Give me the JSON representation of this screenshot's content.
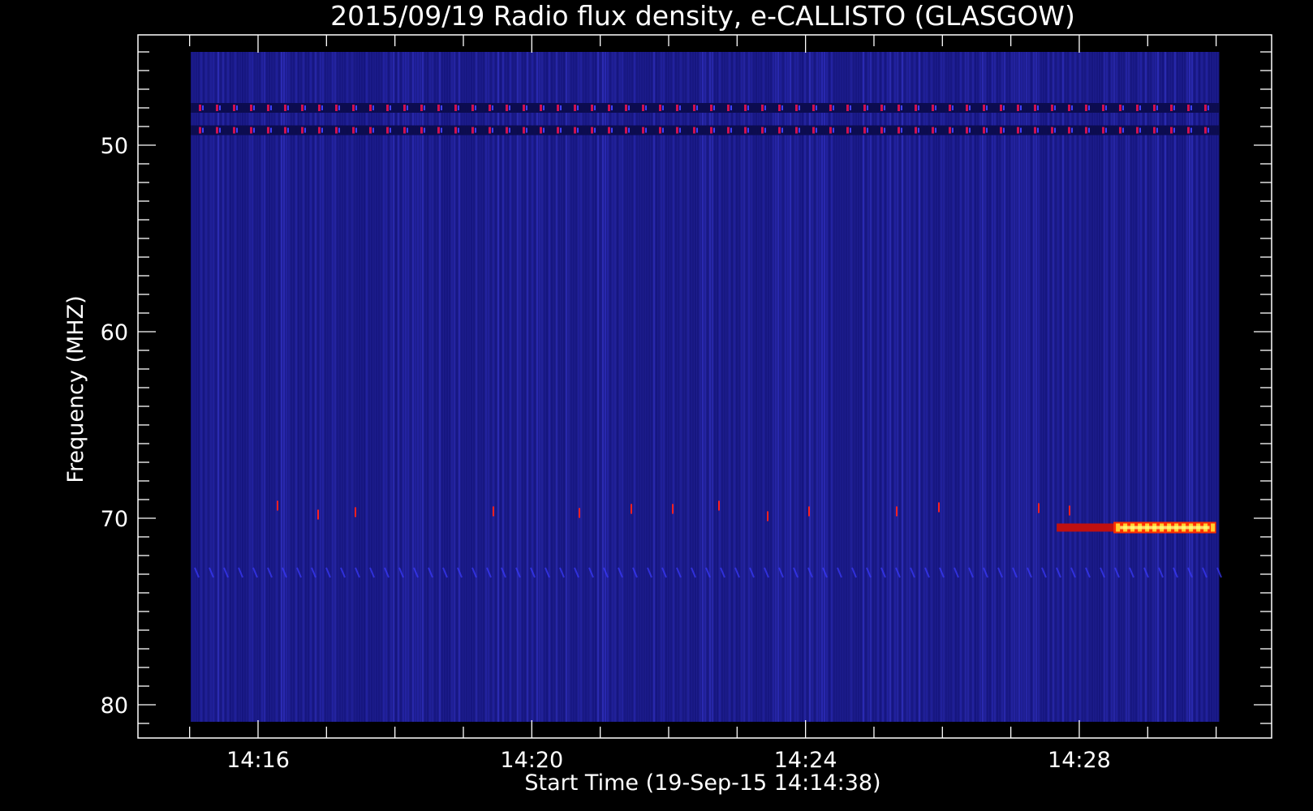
{
  "chart_data": {
    "type": "heatmap",
    "title": "2015/09/19  Radio flux density, e-CALLISTO (GLASGOW)",
    "xlabel": "Start Time (19-Sep-15 14:14:38)",
    "ylabel": "Frequency (MHZ)",
    "x_ticks": [
      "14:16",
      "14:20",
      "14:24",
      "14:28"
    ],
    "y_ticks": [
      "50",
      "60",
      "70",
      "80"
    ],
    "x_range_minutes": [
      "14:14:38",
      "14:30:00"
    ],
    "y_range_mhz": [
      45,
      81
    ],
    "y_inverted": true,
    "colormap": [
      "#00002a",
      "#1a1aa0",
      "#3a3aff",
      "#ff0000",
      "#ffa000",
      "#ffff60"
    ],
    "background_color": "#1c1c8c",
    "features": [
      {
        "name": "interference band",
        "freq_mhz": 48,
        "pattern": "periodic red dots"
      },
      {
        "name": "interference band",
        "freq_mhz": 49.2,
        "pattern": "periodic red dots"
      },
      {
        "name": "faint drifting streaks",
        "freq_mhz": 73
      },
      {
        "name": "sporadic bursts",
        "freq_mhz": 69.5
      },
      {
        "name": "strong emission",
        "freq_mhz": 70.5,
        "time_start": "14:28:30",
        "time_end": "14:30:00"
      }
    ]
  }
}
